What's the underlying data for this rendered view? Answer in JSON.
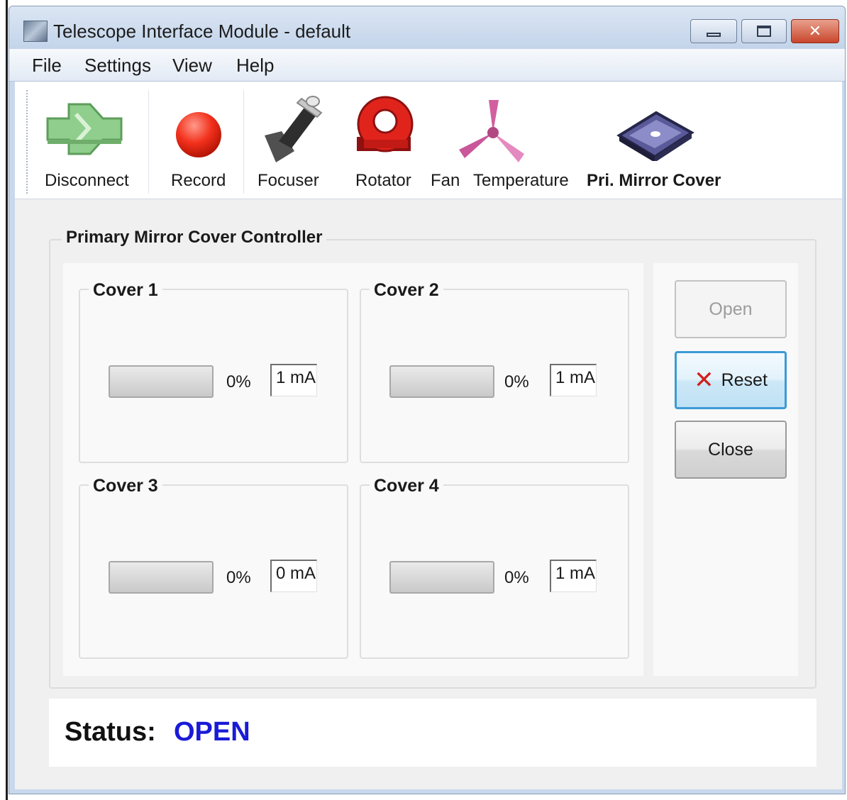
{
  "window": {
    "title": "Telescope Interface Module - default",
    "controls": {
      "minimize": "minimize-icon",
      "maximize": "maximize-icon",
      "close": "✕"
    }
  },
  "menu": {
    "items": [
      "File",
      "Settings",
      "View",
      "Help"
    ]
  },
  "toolbar": {
    "items": [
      {
        "label": "Disconnect",
        "icon": "disconnect-icon"
      },
      {
        "label": "Record",
        "icon": "record-icon"
      },
      {
        "label": "Focuser",
        "icon": "focuser-icon"
      },
      {
        "label": "Rotator",
        "icon": "rotator-icon"
      },
      {
        "label": "Fan",
        "icon": "fan-icon"
      },
      {
        "label": "Temperature",
        "icon": "temperature-icon"
      },
      {
        "label": "Pri. Mirror Cover",
        "icon": "mirror-cover-icon"
      }
    ]
  },
  "controller": {
    "title": "Primary Mirror Cover Controller",
    "covers": [
      {
        "name": "Cover 1",
        "percent_label": "0%",
        "progress": 0,
        "current": "1 mA"
      },
      {
        "name": "Cover 2",
        "percent_label": "0%",
        "progress": 0,
        "current": "1 mA"
      },
      {
        "name": "Cover 3",
        "percent_label": "0%",
        "progress": 0,
        "current": "0 mA"
      },
      {
        "name": "Cover 4",
        "percent_label": "0%",
        "progress": 0,
        "current": "1 mA"
      }
    ],
    "buttons": {
      "open": "Open",
      "reset": "Reset",
      "close": "Close"
    }
  },
  "status": {
    "label": "Status:",
    "value": "OPEN",
    "value_color": "#1a1ad8"
  }
}
